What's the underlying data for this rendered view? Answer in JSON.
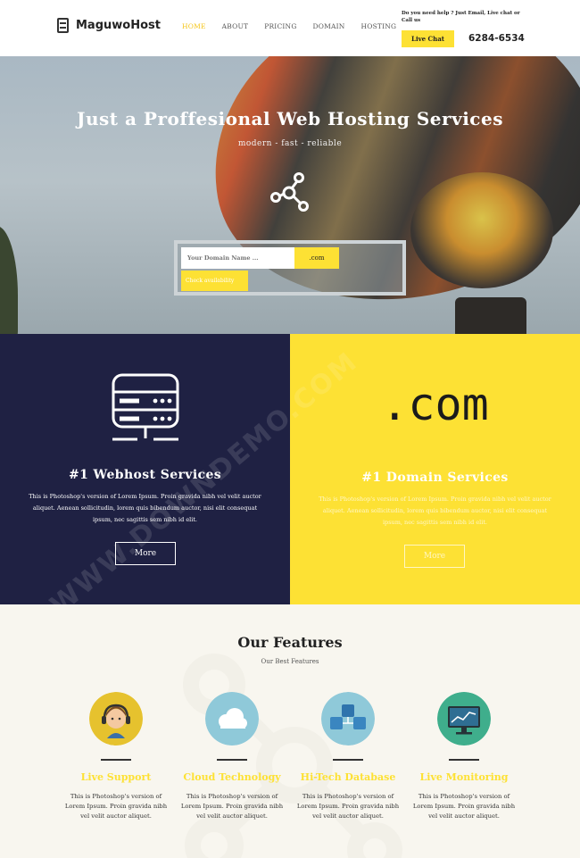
{
  "header": {
    "logo_text": "MaguwoHost",
    "nav": [
      "HOME",
      "ABOUT",
      "PRICING",
      "DOMAIN",
      "HOSTING"
    ],
    "help_text": "Do you need help ? Just Email, Live chat or Call us",
    "live_chat_label": "Live Chat",
    "phone": "6284-6534"
  },
  "hero": {
    "title": "Just a Proffesional Web Hosting Services",
    "subtitle": "modern - fast - reliable",
    "domain_placeholder": "Your Domain Name ...",
    "extension": ".com",
    "check_label": "Check availability"
  },
  "services": {
    "left": {
      "title": "#1 Webhost Services",
      "desc": "This is Photoshop's version of Lorem Ipsum. Proin gravida nibh vel velit auctor aliquet. Aenean sollicitudin, lorem quis bibendum auctor, nisi elit consequat ipsum, nec sagittis sem nibh id elit.",
      "more_label": "More"
    },
    "right": {
      "logo_text": ".com",
      "title": "#1 Domain Services",
      "desc": "This is Photoshop's version of Lorem Ipsum. Proin gravida nibh vel velit auctor aliquet. Aenean sollicitudin, lorem quis bibendum auctor, nisi elit consequat ipsum, nec sagittis sem nibh id elit.",
      "more_label": "More"
    }
  },
  "features": {
    "title": "Our Features",
    "subtitle": "Our Best Features",
    "items": [
      {
        "name": "Live Support",
        "icon": "headset-support-icon",
        "desc": "This is Photoshop's version of Lorem Ipsum. Proin gravida nibh vel velit auctor aliquet."
      },
      {
        "name": "Cloud Technology",
        "icon": "cloud-icon",
        "desc": "This is Photoshop's version of Lorem Ipsum. Proin gravida nibh vel velit auctor aliquet."
      },
      {
        "name": "Hi-Tech Database",
        "icon": "database-icon",
        "desc": "This is Photoshop's version of Lorem Ipsum. Proin gravida nibh vel velit auctor aliquet."
      },
      {
        "name": "Live Monitoring",
        "icon": "monitor-chart-icon",
        "desc": "This is Photoshop's version of Lorem Ipsum. Proin gravida nibh vel velit auctor aliquet."
      }
    ]
  },
  "watermark": "WWW.DOWNDEMO.COM",
  "colors": {
    "accent_yellow": "#fde134",
    "navy": "#1f2143",
    "cream": "#f8f6ef"
  }
}
